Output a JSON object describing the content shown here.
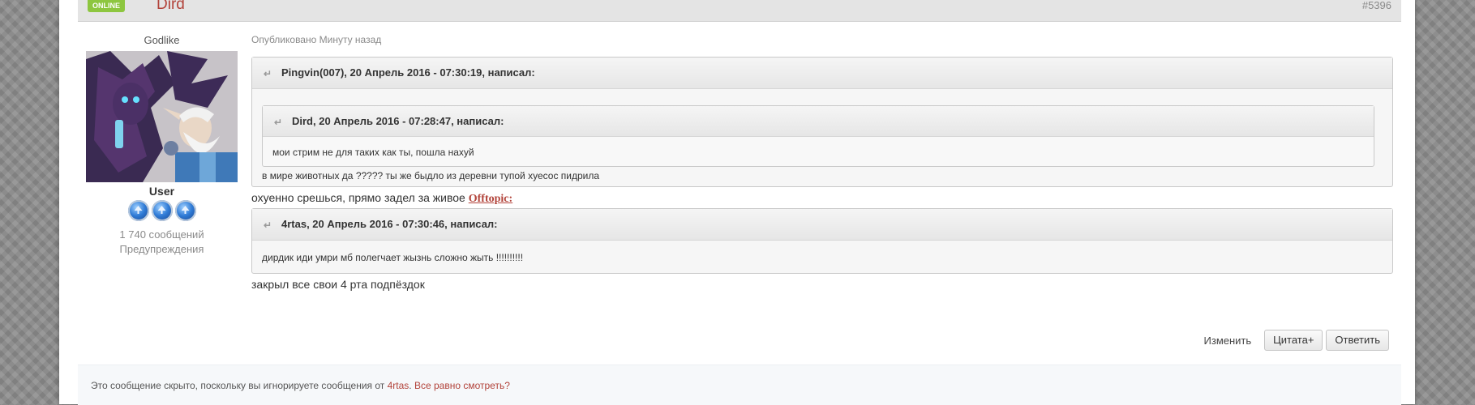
{
  "post": {
    "online_badge": "ONLINE",
    "author": "Dird",
    "number": "#5396",
    "posted_date": "Опубликовано Минуту назад"
  },
  "user": {
    "title": "Godlike",
    "group": "User",
    "posts_count": "1 740 сообщений",
    "warnings": "Предупреждения",
    "pips_count": 3
  },
  "quote1": {
    "header": "Pingvin(007), 20 Апрель 2016 - 07:30:19, написал:",
    "nested_header": "Dird, 20 Апрель 2016 - 07:28:47, написал:",
    "nested_text": "мои стрим не для таких как ты, пошла нахуй",
    "text": "в мире животных да ????? ты же быдло из деревни   тупой хуесос пидрила"
  },
  "reply_line1": {
    "text": "охуенно срешься, прямо задел за живое ",
    "link": "Offtopic:"
  },
  "quote2": {
    "header": "4rtas, 20 Апрель 2016 - 07:30:46, написал:",
    "text": "дирдик иди умри мб полегчает жызнь сложно жыть !!!!!!!!!!"
  },
  "reply_line2": "закрыл все свои 4 рта подпёздок",
  "actions": {
    "edit": "Изменить",
    "quote_plus": "Цитата+",
    "reply": "Ответить"
  },
  "ignored": {
    "text": "Это сообщение скрыто, поскольку вы игнорируете сообщения от ",
    "user": "4rtas",
    "separator": ". ",
    "view_link": "Все равно смотреть?"
  },
  "colors": {
    "accent": "#b2433a",
    "online": "#8dc63f"
  }
}
